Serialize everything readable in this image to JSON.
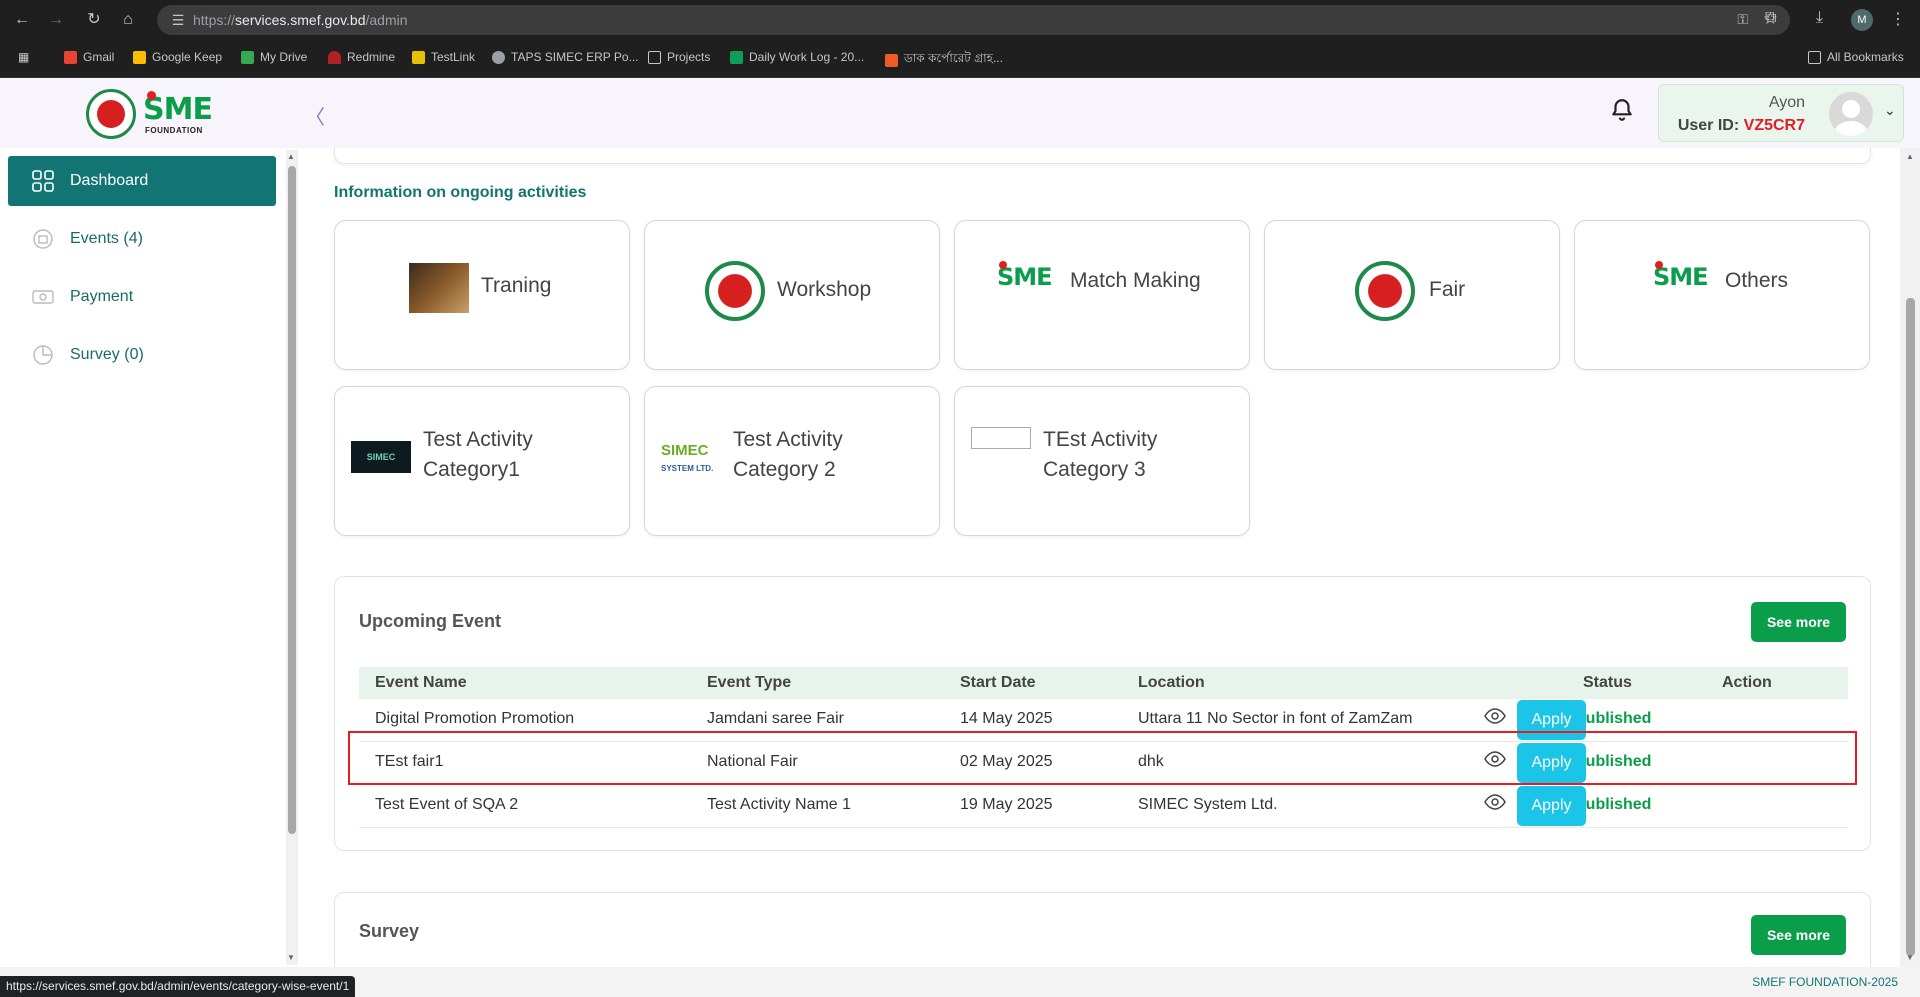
{
  "browser": {
    "url_prefix": "https://",
    "url_domain": "services.smef.gov.bd",
    "url_path": "/admin",
    "profile_initial": "M",
    "bookmarks": [
      "Gmail",
      "Google Keep",
      "My Drive",
      "Redmine",
      "TestLink",
      "TAPS SIMEC ERP Po...",
      "Projects",
      "Daily Work Log - 20...",
      "ডাক কর্পোরেট গ্রাহ..."
    ],
    "all_bookmarks": "All Bookmarks",
    "status_url": "https://services.smef.gov.bd/admin/events/category-wise-event/1"
  },
  "header": {
    "logo_text": "SME",
    "logo_sub": "FOUNDATION",
    "user_name": "Ayon",
    "user_id_label": "User ID:",
    "user_id_value": "VZ5CR7"
  },
  "sidebar": {
    "items": [
      {
        "label": "Dashboard"
      },
      {
        "label": "Events (4)"
      },
      {
        "label": "Payment"
      },
      {
        "label": "Survey (0)"
      }
    ]
  },
  "main": {
    "section_title": "Information on ongoing activities",
    "activities": [
      {
        "label": "Traning",
        "icon": "training-thumbnail"
      },
      {
        "label": "Workshop",
        "icon": "government-seal-logo"
      },
      {
        "label": "Match Making",
        "icon": "sme-logo"
      },
      {
        "label": "Fair",
        "icon": "government-seal-logo"
      },
      {
        "label": "Others",
        "icon": "sme-logo"
      },
      {
        "label": "Test Activity Category1",
        "icon": "simec-dark-logo"
      },
      {
        "label": "Test Activity Category 2",
        "icon": "simec-green-logo"
      },
      {
        "label": "TEst Activity Category 3",
        "icon": "broken-image"
      }
    ],
    "upcoming": {
      "title": "Upcoming Event",
      "see_more": "See more",
      "columns": [
        "Event Name",
        "Event Type",
        "Start Date",
        "Location",
        "Status",
        "Action"
      ],
      "rows": [
        {
          "name": "Digital Promotion Promotion",
          "type": "Jamdani saree Fair",
          "date": "14 May 2025",
          "location": "Uttara 11 No Sector in font of ZamZam",
          "status": "Published",
          "action": "Apply"
        },
        {
          "name": "TEst fair1",
          "type": "National Fair",
          "date": "02 May 2025",
          "location": "dhk",
          "status": "Published",
          "action": "Apply"
        },
        {
          "name": "Test Event of SQA 2",
          "type": "Test Activity Name 1",
          "date": "19 May 2025",
          "location": "SIMEC System Ltd.",
          "status": "Published",
          "action": "Apply"
        }
      ]
    },
    "survey": {
      "title": "Survey",
      "see_more": "See more"
    }
  },
  "footer": {
    "copyright": "SMEF FOUNDATION-2025"
  },
  "colors": {
    "primary": "#127574",
    "success": "#0b9e4a",
    "apply": "#1bc5e8",
    "highlight": "#e31d24"
  }
}
